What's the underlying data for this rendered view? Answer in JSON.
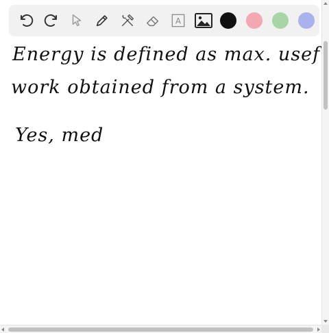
{
  "toolbar": {
    "tools": [
      {
        "name": "undo-icon"
      },
      {
        "name": "redo-icon"
      },
      {
        "name": "pointer-icon"
      },
      {
        "name": "pen-icon"
      },
      {
        "name": "tools-icon"
      },
      {
        "name": "eraser-icon"
      },
      {
        "name": "text-icon",
        "glyph": "A"
      },
      {
        "name": "image-icon"
      }
    ],
    "colors": [
      "#111111",
      "#f2a7b1",
      "#a8d5a8",
      "#a9b2ec"
    ]
  },
  "handwriting": {
    "line1": "Energy is defined as max. useful",
    "line2": "work obtained from a system.",
    "line3": "Yes, med"
  }
}
